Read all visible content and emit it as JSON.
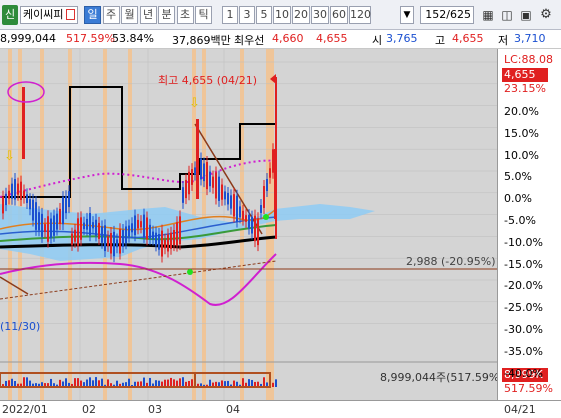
{
  "toolbar": {
    "logo": "신",
    "stock_name": "케이씨피",
    "stock_code_icon": "flag-icon",
    "periods": [
      "일",
      "주",
      "월",
      "년",
      "분",
      "초",
      "틱"
    ],
    "active_period": "일",
    "ranges": [
      "1",
      "3",
      "5",
      "10",
      "20",
      "30",
      "60",
      "120"
    ],
    "page_indicator": "152/625"
  },
  "info": {
    "volume": "8,999,044",
    "vol_change": "517.59%",
    "turnover": "53.84%",
    "trade_value": "37,869백만",
    "best_ask_label": "최우선",
    "best_ask": "4,660",
    "best_bid": "4,655",
    "open_label": "시",
    "open": "3,765",
    "high_label": "고",
    "high": "4,655",
    "low_label": "저",
    "low": "3,710"
  },
  "chart": {
    "high_annotation": "최고 4,655 (04/21)",
    "price_line_label": "2,988 (-20.95%)",
    "volume_label": "8,999,044주(517.59%)",
    "partial_label": "(11/30)",
    "lc_label": "LC:88.08",
    "price_box": "4,655",
    "pct_box": "23.15%",
    "vol_box": "8,999K",
    "vol_pct": "517.59%"
  },
  "y_axis": [
    "20.0%",
    "15.0%",
    "10.0%",
    "5.0%",
    "0.0%",
    "-5.0%",
    "-10.0%",
    "-15.0%",
    "-20.0%",
    "-25.0%",
    "-30.0%",
    "-35.0%",
    "-40.0%"
  ],
  "x_axis": [
    "2022/01",
    "02",
    "03",
    "04",
    "04/21"
  ],
  "colors": {
    "up": "#e02020",
    "down": "#1a4fd0",
    "highlight_band": "#f5c08a",
    "cloud": "#8ecbf5"
  }
}
